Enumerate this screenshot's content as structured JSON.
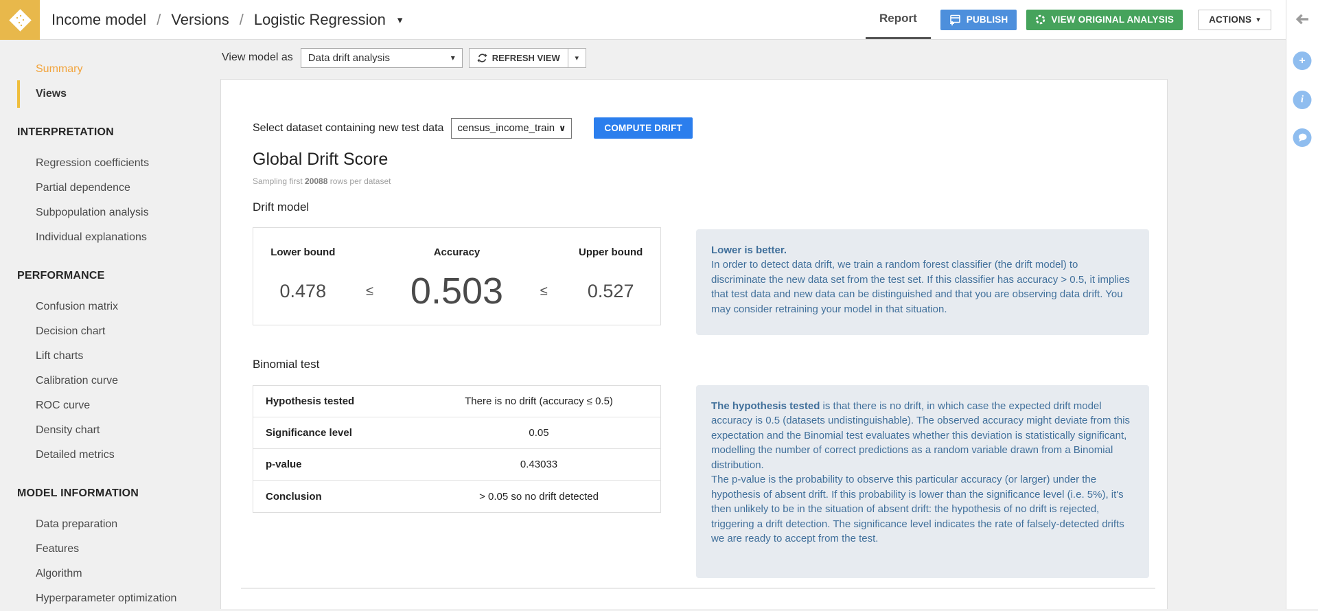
{
  "colors": {
    "logo_bg": "#E8B84B",
    "accent_orange": "#F2A43C",
    "active_bar_yellow": "#EFBE3C",
    "publish_blue": "#4D8FDC",
    "compute_blue": "#2B7EED",
    "analysis_green": "#46A35C",
    "info_box_bg": "#E7EBF0",
    "info_text_blue": "#41709B",
    "rail_circle_blue": "#8FBDEF"
  },
  "icons": {
    "caret_down": "▾",
    "select_caret": "∨",
    "plus": "+",
    "info": "i"
  },
  "header": {
    "breadcrumb": [
      "Income model",
      "Versions",
      "Logistic Regression"
    ],
    "separator": "/",
    "report_tab": "Report",
    "publish": "PUBLISH",
    "view_original": "VIEW ORIGINAL ANALYSIS",
    "actions": "ACTIONS"
  },
  "sidebar": {
    "summary": "Summary",
    "views": "Views",
    "sections": [
      {
        "title": "INTERPRETATION",
        "items": [
          "Regression coefficients",
          "Partial dependence",
          "Subpopulation analysis",
          "Individual explanations"
        ]
      },
      {
        "title": "PERFORMANCE",
        "items": [
          "Confusion matrix",
          "Decision chart",
          "Lift charts",
          "Calibration curve",
          "ROC curve",
          "Density chart",
          "Detailed metrics"
        ]
      },
      {
        "title": "MODEL INFORMATION",
        "items": [
          "Data preparation",
          "Features",
          "Algorithm",
          "Hyperparameter optimization"
        ]
      }
    ]
  },
  "toolbar": {
    "view_model_as": "View model as",
    "view_value": "Data drift analysis",
    "refresh": "REFRESH VIEW"
  },
  "main": {
    "dataset_label": "Select dataset containing new test data",
    "dataset_value": "census_income_train",
    "compute": "COMPUTE DRIFT",
    "title": "Global Drift Score",
    "sampling": {
      "prefix": "Sampling first ",
      "count": "20088",
      "suffix": " rows per dataset"
    },
    "drift_model": {
      "title": "Drift model",
      "col_lower": "Lower bound",
      "col_accuracy": "Accuracy",
      "col_upper": "Upper bound",
      "lower": "0.478",
      "accuracy": "0.503",
      "upper": "0.527",
      "lte": "≤"
    },
    "drift_info": {
      "lead": "Lower is better.",
      "body": "In order to detect data drift, we train a random forest classifier (the drift model) to discriminate the new data set from the test set. If this classifier has accuracy > 0.5, it implies that test data and new data can be distinguished and that you are observing data drift. You may consider retraining your model in that situation."
    },
    "binomial": {
      "title": "Binomial test",
      "rows": [
        {
          "label": "Hypothesis tested",
          "value": "There is no drift (accuracy ≤ 0.5)"
        },
        {
          "label": "Significance level",
          "value": "0.05"
        },
        {
          "label": "p-value",
          "value": "0.43033"
        },
        {
          "label": "Conclusion",
          "value": "> 0.05 so no drift detected"
        }
      ]
    },
    "binomial_info": {
      "lead": "The hypothesis tested",
      "body1": " is that there is no drift, in which case the expected drift model accuracy is 0.5 (datasets undistinguishable). The observed accuracy might deviate from this expectation and the Binomial test evaluates whether this deviation is statistically significant, modelling the number of correct predictions as a random variable drawn from a Binomial distribution.",
      "body2": "The p-value is the probability to observe this particular accuracy (or larger) under the hypothesis of absent drift. If this probability is lower than the significance level (i.e. 5%), it's then unlikely to be in the situation of absent drift: the hypothesis of no drift is rejected, triggering a drift detection. The significance level indicates the rate of falsely-detected drifts we are ready to accept from the test."
    }
  }
}
